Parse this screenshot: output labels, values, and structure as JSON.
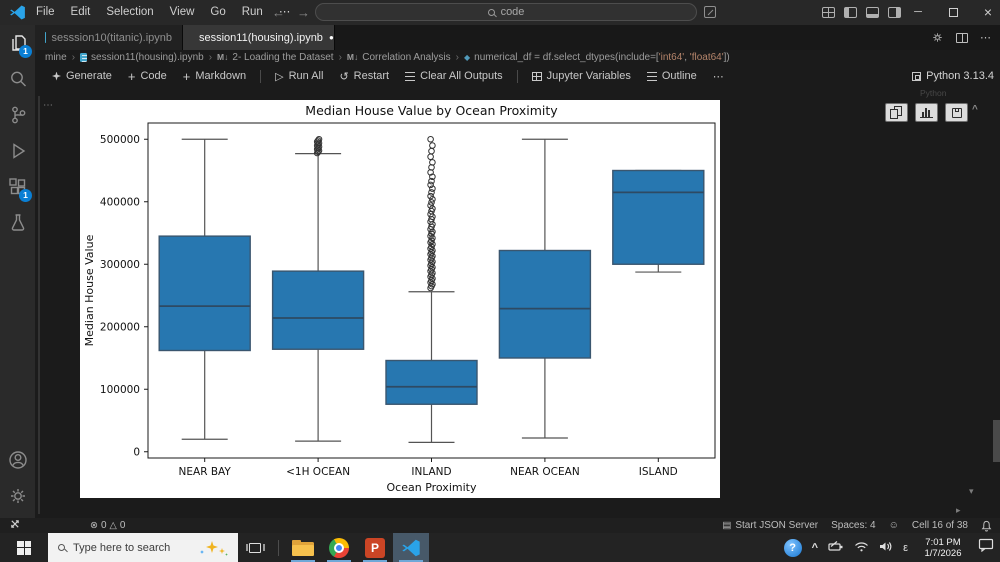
{
  "titlebar": {
    "menus": {
      "file": "File",
      "edit": "Edit",
      "selection": "Selection",
      "view": "View",
      "go": "Go",
      "run": "Run"
    },
    "more": "⋯",
    "nav_back": "←",
    "nav_forward": "→",
    "command_center": "code",
    "window_minimize": "─",
    "window_close": "×"
  },
  "activitybar": {
    "explorer_badge": "1",
    "extensions_badge": "1"
  },
  "tabs": {
    "tab1_label": "sesssion10(titanic).ipynb",
    "tab2_label": "session11(housing).ipynb",
    "dirty_dot": "●",
    "more": "⋯"
  },
  "breadcrumb": {
    "root": "mine",
    "sep": "›",
    "file": "session11(housing).ipynb",
    "md_icon": "M↓",
    "section_loading": "2- Loading the Dataset",
    "section_corr": "Correlation Analysis",
    "symbol_icon": "◆",
    "code_pre": "numerical_df = df.select_dtypes(include=[",
    "code_str1": "'int64'",
    "code_comma": ", ",
    "code_str2": "'float64'",
    "code_post": "])"
  },
  "toolbar": {
    "generate": "Generate",
    "plus": "+",
    "add_code": "Code",
    "add_markdown": "Markdown",
    "run_glyph": "▷",
    "run_all": "Run All",
    "restart_glyph": "↺",
    "restart": "Restart",
    "clear_outputs": "Clear All Outputs",
    "variables": "Jupyter Variables",
    "outline": "Outline",
    "more": "⋯",
    "kernel": "Python 3.13.4",
    "kernel_ghost": "Python"
  },
  "cell": {
    "gutter_more": "⋯"
  },
  "editor": {
    "collapse_caret": "^",
    "more_below": "▾",
    "more_right": "▸"
  },
  "statusbar": {
    "error_glyph": "⊗",
    "errors": "0",
    "warning_glyph": "△",
    "warnings": "0",
    "server_glyph": "▤",
    "server": "Start JSON Server",
    "spaces": "Spaces: 4",
    "feedback_glyph": "☺",
    "cell_pos": "Cell 16 of 38"
  },
  "taskbar": {
    "search": "Type here to search",
    "ppt_letter": "P",
    "hidden_caret": "^",
    "lang": "ε",
    "time": "7:01 PM",
    "date": "1/7/2026"
  },
  "chart_data": {
    "type": "boxplot",
    "title": "Median House Value by Ocean Proximity",
    "xlabel": "Ocean Proximity",
    "ylabel": "Median House Value",
    "categories": [
      "NEAR BAY",
      "<1H OCEAN",
      "INLAND",
      "NEAR OCEAN",
      "ISLAND"
    ],
    "ylim": [
      -10000,
      526000
    ],
    "yticks": [
      0,
      100000,
      200000,
      300000,
      400000,
      500000
    ],
    "grid": false,
    "box_fill": "#2777b0",
    "box_edge": "#3a566f",
    "median_color": "#2e4a63",
    "whisker_color": "#545454",
    "flier_color": "#333333",
    "series": [
      {
        "name": "NEAR BAY",
        "whislo": 20000,
        "q1": 162000,
        "med": 233000,
        "q3": 345000,
        "whishi": 500000,
        "fliers": []
      },
      {
        "name": "<1H OCEAN",
        "whislo": 17000,
        "q1": 164000,
        "med": 214000,
        "q3": 289000,
        "whishi": 477000,
        "fliers": [
          478000,
          480000,
          482000,
          484000,
          486000,
          488000,
          490000,
          492000,
          494000,
          496000,
          498000,
          500000
        ]
      },
      {
        "name": "INLAND",
        "whislo": 15000,
        "q1": 76000,
        "med": 104000,
        "q3": 146000,
        "whishi": 256000,
        "fliers": [
          262000,
          265000,
          268000,
          271000,
          274000,
          277000,
          280000,
          283000,
          286000,
          289000,
          292000,
          295000,
          298000,
          301000,
          304000,
          307000,
          310000,
          313000,
          316000,
          319000,
          322000,
          325000,
          328000,
          332000,
          335000,
          338000,
          342000,
          345000,
          349000,
          352000,
          356000,
          360000,
          364000,
          368000,
          372000,
          376000,
          380000,
          385000,
          389000,
          394000,
          399000,
          404000,
          409000,
          415000,
          421000,
          427000,
          433000,
          440000,
          447000,
          455000,
          463000,
          472000,
          481000,
          490000,
          500000
        ]
      },
      {
        "name": "NEAR OCEAN",
        "whislo": 22000,
        "q1": 150000,
        "med": 229000,
        "q3": 322000,
        "whishi": 500000,
        "fliers": []
      },
      {
        "name": "ISLAND",
        "whislo": 287500,
        "q1": 300000,
        "med": 415000,
        "q3": 450000,
        "whishi": 450000,
        "fliers": []
      }
    ]
  }
}
